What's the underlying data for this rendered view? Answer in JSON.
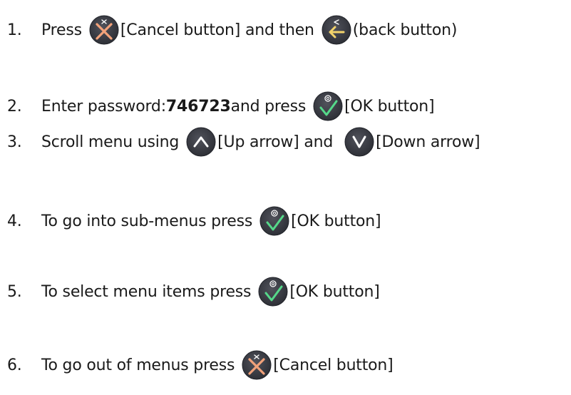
{
  "steps": [
    {
      "number": "1.",
      "t1": "Press",
      "t2": "[Cancel button] and then",
      "t3": "(back button)"
    },
    {
      "number": "2.",
      "t1": "Enter password: ",
      "password": "746723",
      "t2": " and press",
      "t3": "[OK button]"
    },
    {
      "number": "3.",
      "t1": "Scroll menu using",
      "t2": "[Up arrow] and",
      "t3": "[Down arrow]"
    },
    {
      "number": "4.",
      "t1": "To go into sub-menus press",
      "t2": "[OK button]"
    },
    {
      "number": "5.",
      "t1": "To select menu items press",
      "t2": "[OK button]"
    },
    {
      "number": "6.",
      "t1": "To go out of menus press",
      "t2": "[Cancel button]"
    }
  ],
  "icons": {
    "button_face": "#3d3f47",
    "cancel_color": "#f2a27a",
    "back_color": "#f2d36b",
    "ok_color": "#55d98a",
    "arrow_color": "#ffffff"
  }
}
